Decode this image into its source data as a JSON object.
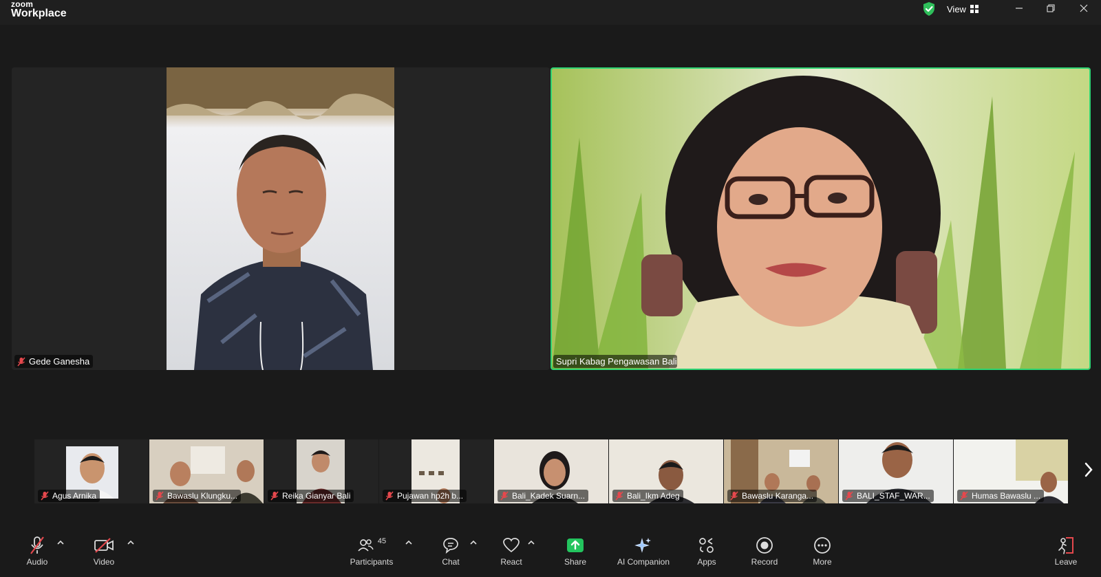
{
  "app": {
    "brand_small": "zoom",
    "brand_large": "Workplace",
    "view_label": "View"
  },
  "speakers": [
    {
      "name": "Gede Ganesha",
      "muted": true
    },
    {
      "name": "Supri Kabag Pengawasan Bali",
      "muted": false,
      "active": true
    }
  ],
  "thumbnails": [
    {
      "name": "Agus Arnika"
    },
    {
      "name": "Bawaslu Klungku..."
    },
    {
      "name": "Reika Gianyar Bali"
    },
    {
      "name": "Pujawan  hp2h b..."
    },
    {
      "name": "Bali_Kadek Suarn..."
    },
    {
      "name": "Bali_Ikm Adeg"
    },
    {
      "name": "Bawaslu Karanga..."
    },
    {
      "name": "BALI_STAF_WAR..."
    },
    {
      "name": "Humas Bawaslu ..."
    }
  ],
  "toolbar": {
    "audio": "Audio",
    "video": "Video",
    "participants": "Participants",
    "participants_count": "45",
    "chat": "Chat",
    "react": "React",
    "share": "Share",
    "ai": "AI Companion",
    "apps": "Apps",
    "record": "Record",
    "more": "More",
    "leave": "Leave"
  },
  "colors": {
    "active_border": "#2ed573",
    "share_green": "#23c45e",
    "muted_red": "#e5484d"
  }
}
